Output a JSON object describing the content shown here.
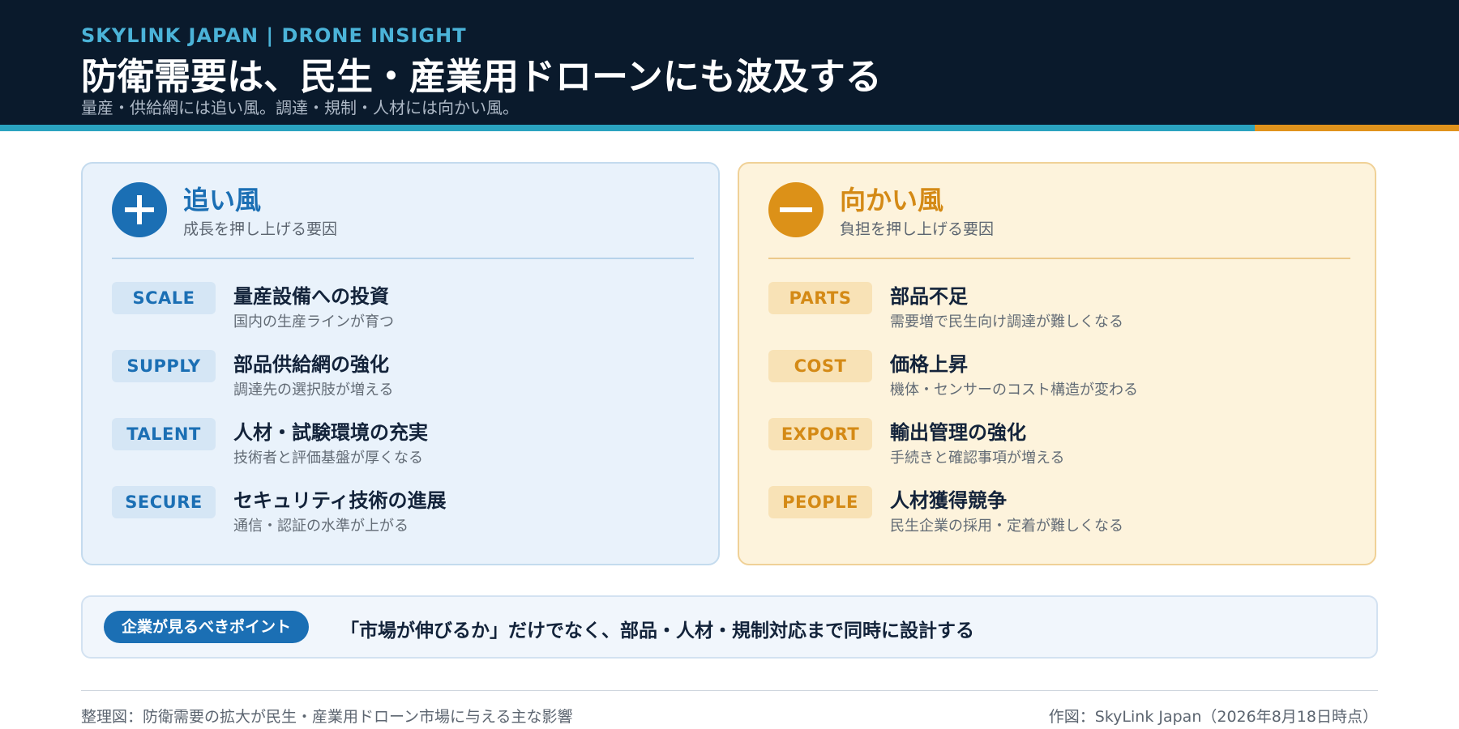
{
  "header": {
    "eyebrow": "SKYLINK JAPAN | DRONE INSIGHT",
    "title": "防衛需要は、民生・産業用ドローンにも波及する",
    "subtitle": "量産・供給網には追い風。調達・規制・人材には向かい風。"
  },
  "tailwinds": {
    "icon": "plus-icon",
    "title": "追い風",
    "subtitle": "成長を押し上げる要因",
    "accent": "#1b6fb4",
    "items": [
      {
        "tag": "SCALE",
        "title": "量産設備への投資",
        "desc": "国内の生産ラインが育つ"
      },
      {
        "tag": "SUPPLY",
        "title": "部品供給網の強化",
        "desc": "調達先の選択肢が増える"
      },
      {
        "tag": "TALENT",
        "title": "人材・試験環境の充実",
        "desc": "技術者と評価基盤が厚くなる"
      },
      {
        "tag": "SECURE",
        "title": "セキュリティ技術の進展",
        "desc": "通信・認証の水準が上がる"
      }
    ]
  },
  "headwinds": {
    "icon": "minus-icon",
    "title": "向かい風",
    "subtitle": "負担を押し上げる要因",
    "accent": "#dc9118",
    "items": [
      {
        "tag": "PARTS",
        "title": "部品不足",
        "desc": "需要増で民生向け調達が難しくなる"
      },
      {
        "tag": "COST",
        "title": "価格上昇",
        "desc": "機体・センサーのコスト構造が変わる"
      },
      {
        "tag": "EXPORT",
        "title": "輸出管理の強化",
        "desc": "手続きと確認事項が増える"
      },
      {
        "tag": "PEOPLE",
        "title": "人材獲得競争",
        "desc": "民生企業の採用・定着が難しくなる"
      }
    ]
  },
  "point": {
    "badge": "企業が見るべきポイント",
    "text": "「市場が伸びるか」だけでなく、部品・人材・規制対応まで同時に設計する"
  },
  "footer": {
    "left": "整理図：防衛需要の拡大が民生・産業用ドローン市場に与える主な影響",
    "right": "作図：SkyLink Japan（2026年8月18日時点）"
  }
}
